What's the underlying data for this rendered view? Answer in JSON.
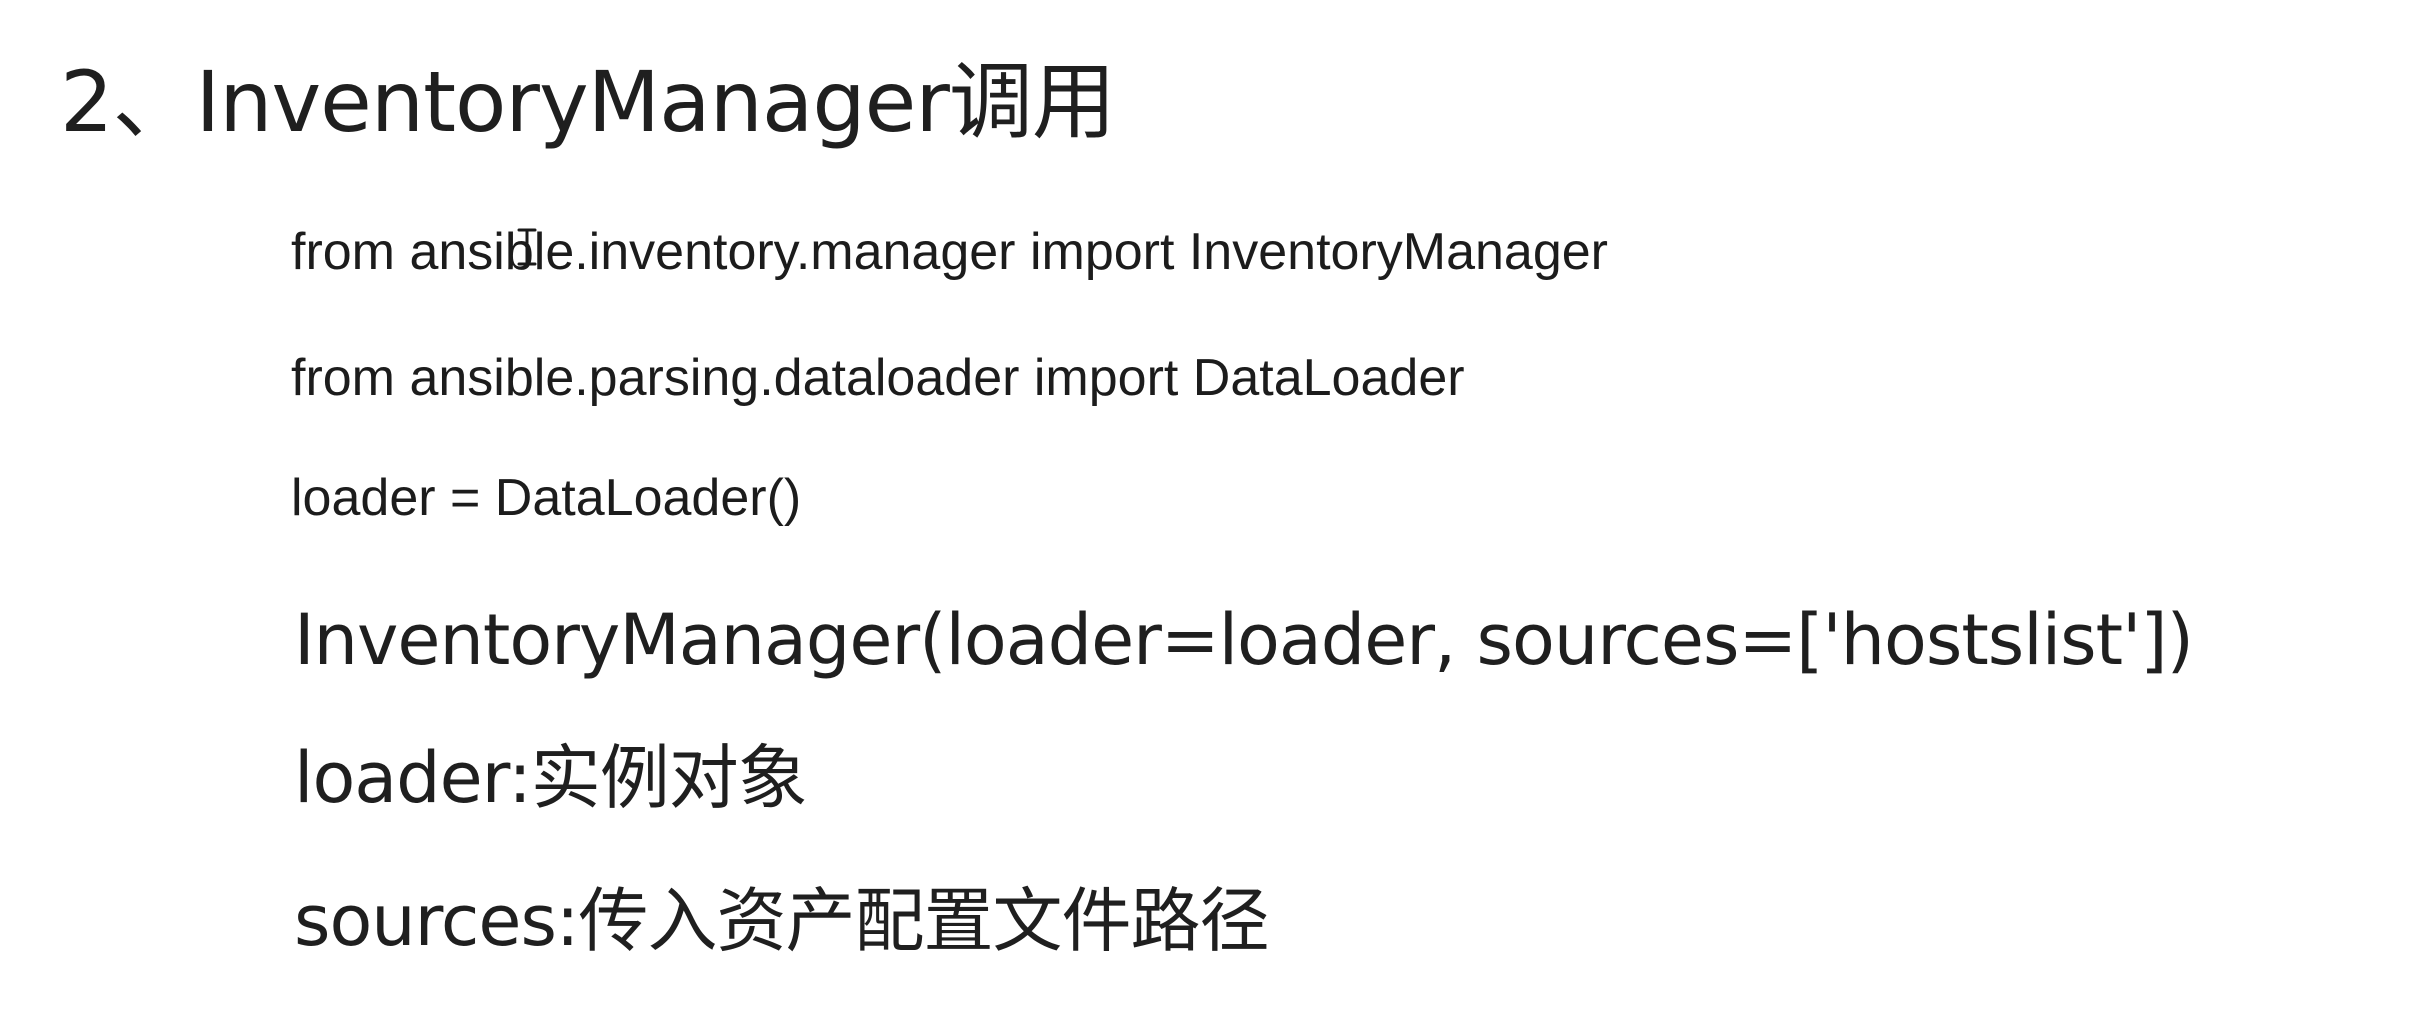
{
  "slide": {
    "title": "2、InventoryManager调用",
    "code_lines": [
      "from ansible.inventory.manager import InventoryManager",
      "from ansible.parsing.dataloader import DataLoader",
      "loader = DataLoader()"
    ],
    "explanations": [
      "InventoryManager(loader=loader, sources=['hostslist'])",
      "loader:实例对象",
      "sources:传入资产配置文件路径"
    ]
  },
  "icons": {
    "cursor": "text-cursor-icon"
  },
  "colors": {
    "background": "#ffffff",
    "text": "#1f1f1f"
  }
}
